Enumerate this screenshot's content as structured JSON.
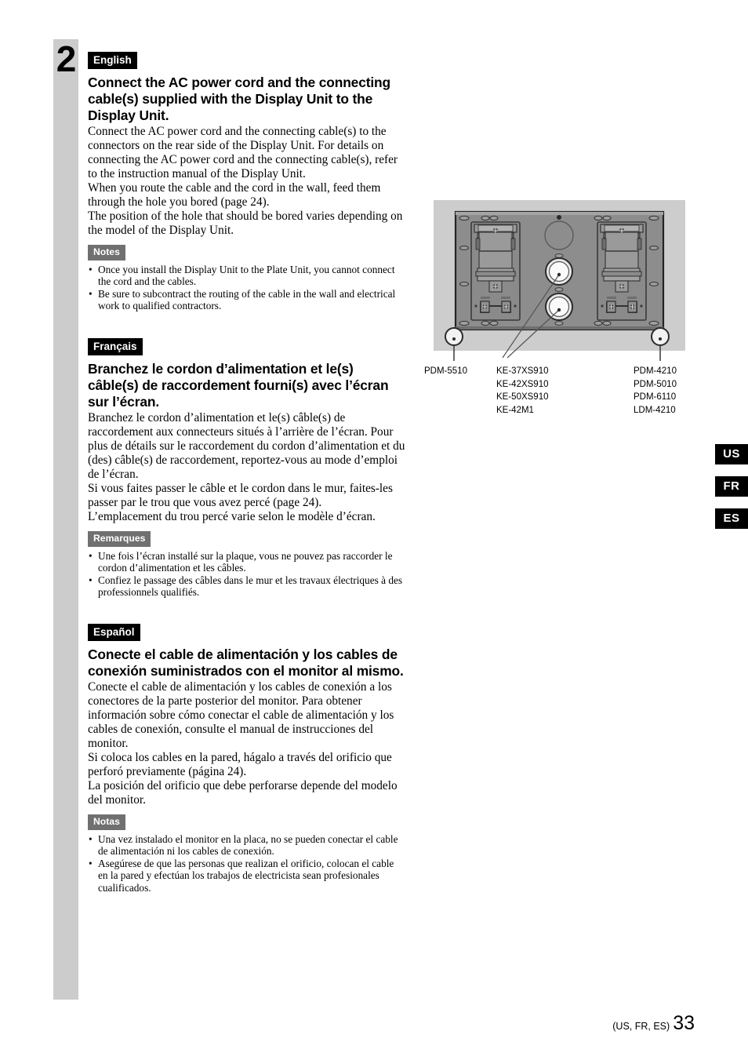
{
  "page": {
    "step_number": "2",
    "footer_note": "(US, FR, ES)",
    "page_number": "33"
  },
  "index_tabs": [
    {
      "label": "US"
    },
    {
      "label": "FR"
    },
    {
      "label": "ES"
    }
  ],
  "sections": {
    "english": {
      "lang_tag": "English",
      "headline": "Connect the AC power cord and the connecting cable(s) supplied with the Display Unit to the Display Unit.",
      "paragraph1": "Connect the AC power cord and the connecting cable(s) to the connectors on the rear side of the Display Unit. For details on connecting the AC power cord and the connecting cable(s), refer to the instruction manual of the Display Unit.",
      "paragraph2": "When you route the cable and the cord in the wall, feed them through the hole you bored (page 24).",
      "paragraph3": "The position of the hole that should be bored varies depending on the model of the Display Unit.",
      "notes_tag": "Notes",
      "notes": [
        "Once you install the Display Unit to the Plate Unit, you cannot connect the cord and the cables.",
        "Be sure to subcontract the routing of the cable in the wall and electrical work to qualified contractors."
      ]
    },
    "french": {
      "lang_tag": "Français",
      "headline": "Branchez le cordon d’alimentation et le(s) câble(s) de raccordement fourni(s) avec l’écran sur l’écran.",
      "paragraph1": "Branchez le cordon d’alimentation et le(s) câble(s) de raccordement aux connecteurs situés à l’arrière de l’écran. Pour plus de détails sur le raccordement du cordon d’alimentation et du (des) câble(s) de raccordement, reportez-vous au mode d’emploi de l’écran.",
      "paragraph2": "Si vous faites passer le câble et le cordon dans le mur, faites-les passer par le trou que vous avez percé (page 24).",
      "paragraph3": "L’emplacement du trou percé varie selon le modèle d’écran.",
      "notes_tag": "Remarques",
      "notes": [
        "Une fois l’écran installé sur la plaque, vous ne pouvez pas raccorder le cordon d’alimentation et les câbles.",
        "Confiez le passage des câbles dans le mur et les travaux électriques à des professionnels qualifiés."
      ]
    },
    "spanish": {
      "lang_tag": "Español",
      "headline": "Conecte el cable de alimentación y los cables de conexión suministrados con el monitor al mismo.",
      "paragraph1": "Conecte el cable de alimentación y los cables de conexión a los conectores de la parte posterior del monitor. Para obtener información sobre cómo conectar el cable de alimentación y los cables de conexión, consulte el manual de instrucciones del monitor.",
      "paragraph2": "Si coloca los cables en la pared, hágalo a través del orificio que perforó previamente (página 24).",
      "paragraph3": "La posición del orificio que debe perforarse depende del modelo del monitor.",
      "notes_tag": "Notas",
      "notes": [
        "Una vez instalado el monitor en la placa, no se pueden conectar el cable de alimentación ni los cables de conexión.",
        "Asegúrese de que las personas que realizan el orificio, colocan el cable en la pared y efectúan los trabajos de electricista sean profesionales cualificados."
      ]
    }
  },
  "figure": {
    "alt": "Rear view of the Plate Unit showing cable routing holes",
    "callout_left": "PDM-5510",
    "callout_middle": "KE-37XS910\nKE-42XS910\nKE-50XS910\nKE-42M1",
    "callout_right": "PDM-4210\nPDM-5010\nPDM-6110\nLDM-4210",
    "colors": {
      "panel_background": "#cdcdcd",
      "plate_body": "#8d8d8d",
      "plate_outline": "#2b2b2b"
    }
  }
}
